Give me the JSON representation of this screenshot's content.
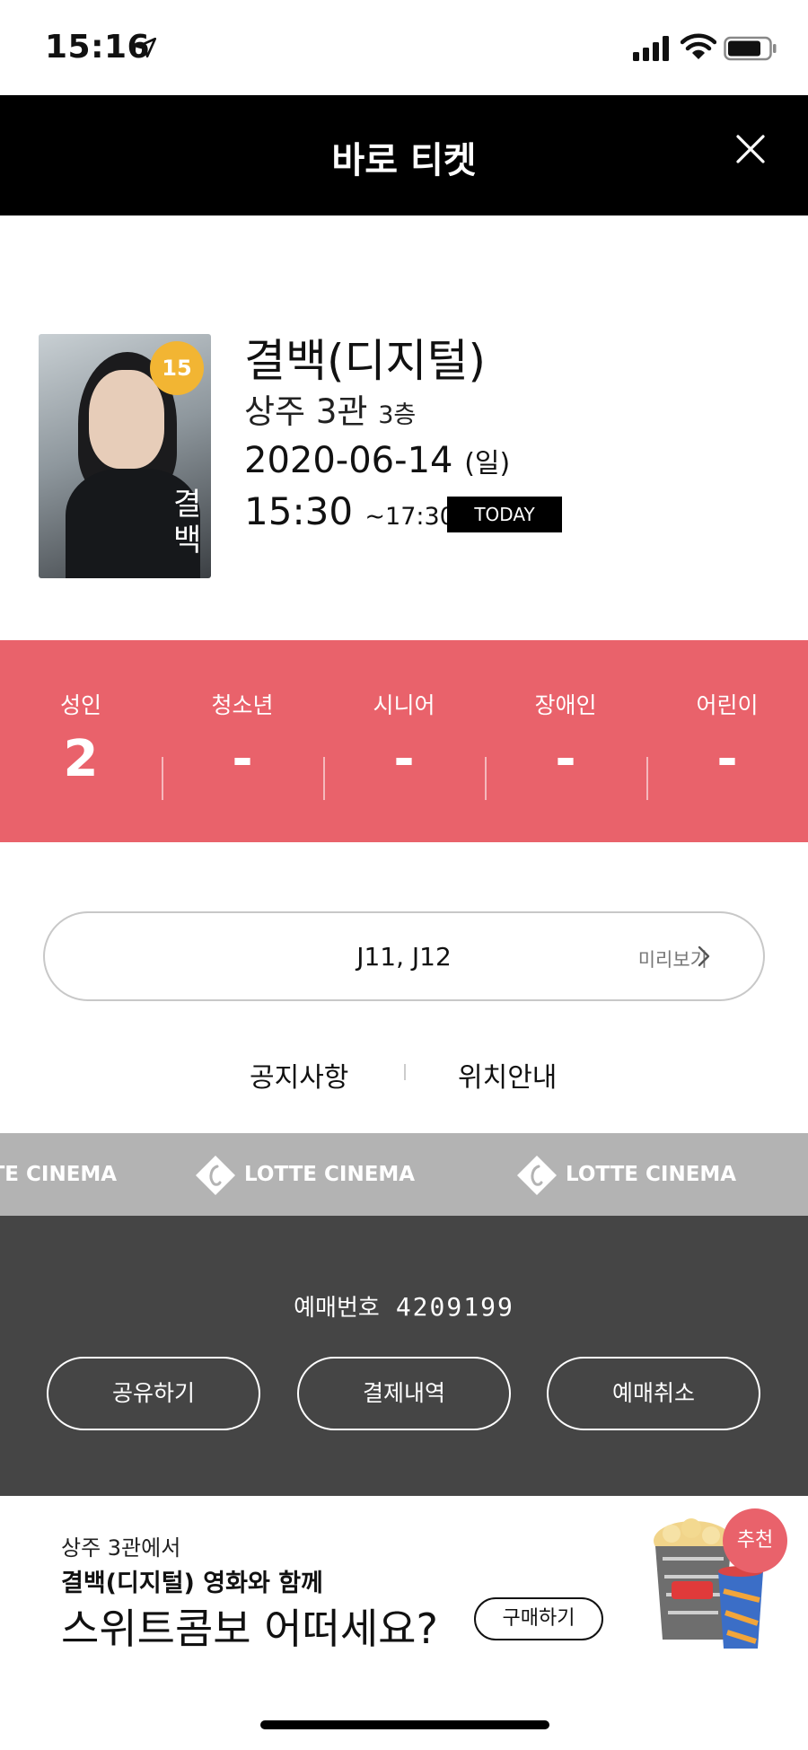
{
  "status": {
    "time": "15:16"
  },
  "header": {
    "title": "바로 티켓"
  },
  "movie": {
    "title": "결백(디지털)",
    "theater": "상주 3관",
    "floor": "3층",
    "date": "2020-06-14",
    "day_of_week": "(일)",
    "start_time": "15:30",
    "end_time": "~17:30",
    "today_label": "TODAY",
    "age_rating": "15",
    "poster_title": "결백"
  },
  "audience": [
    {
      "label": "성인",
      "count": "2"
    },
    {
      "label": "청소년",
      "count": "-"
    },
    {
      "label": "시니어",
      "count": "-"
    },
    {
      "label": "장애인",
      "count": "-"
    },
    {
      "label": "어린이",
      "count": "-"
    }
  ],
  "seats": {
    "value": "J11, J12",
    "preview_label": "미리보기"
  },
  "links": {
    "notice": "공지사항",
    "location": "위치안내"
  },
  "brand": {
    "name": "LOTTE CINEMA"
  },
  "reservation": {
    "label": "예매번호",
    "number": "4209199",
    "buttons": {
      "share": "공유하기",
      "payment": "결제내역",
      "cancel": "예매취소"
    }
  },
  "promo": {
    "line1": "상주 3관에서",
    "line2": "결백(디지털) 영화와 함께",
    "line3": "스위트콤보 어떠세요?",
    "buy_label": "구매하기",
    "badge": "추천"
  },
  "colors": {
    "accent": "#e9626b",
    "dark_panel": "#454545",
    "header": "#000000",
    "brand_band": "#b3b3b3",
    "age_badge": "#f2b533"
  }
}
